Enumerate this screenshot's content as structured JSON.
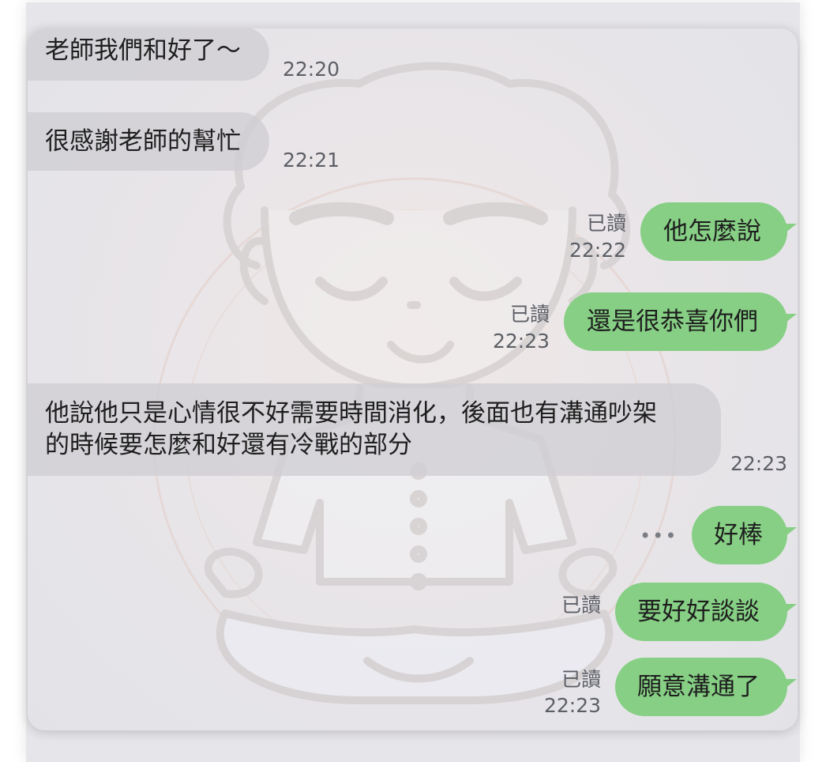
{
  "messages": [
    {
      "side": "in",
      "text": "老師我們和好了～",
      "time": "22:20"
    },
    {
      "side": "in",
      "text": "很感謝老師的幫忙",
      "time": "22:21"
    },
    {
      "side": "out",
      "text": "他怎麼說",
      "read": "已讀",
      "time": "22:22"
    },
    {
      "side": "out",
      "text": "還是很恭喜你們",
      "read": "已讀",
      "time": "22:23"
    },
    {
      "side": "in",
      "lines": [
        "他說他只是心情很不好需要時間消化，後面也有溝通吵架",
        "的時候要怎麼和好還有冷戰的部分"
      ],
      "time": "22:23"
    },
    {
      "side": "out",
      "text": "好棒",
      "typing": "•••"
    },
    {
      "side": "out",
      "text": "要好好談談",
      "read": "已讀"
    },
    {
      "side": "out",
      "text": "願意溝通了",
      "read": "已讀",
      "time": "22:23"
    }
  ],
  "colors": {
    "outgoing_bubble": "#86cf84",
    "incoming_bubble": "#d0ced4",
    "meta_text": "#5c5f66"
  },
  "wallpaper_icon": "meditating-cartoon-boy"
}
